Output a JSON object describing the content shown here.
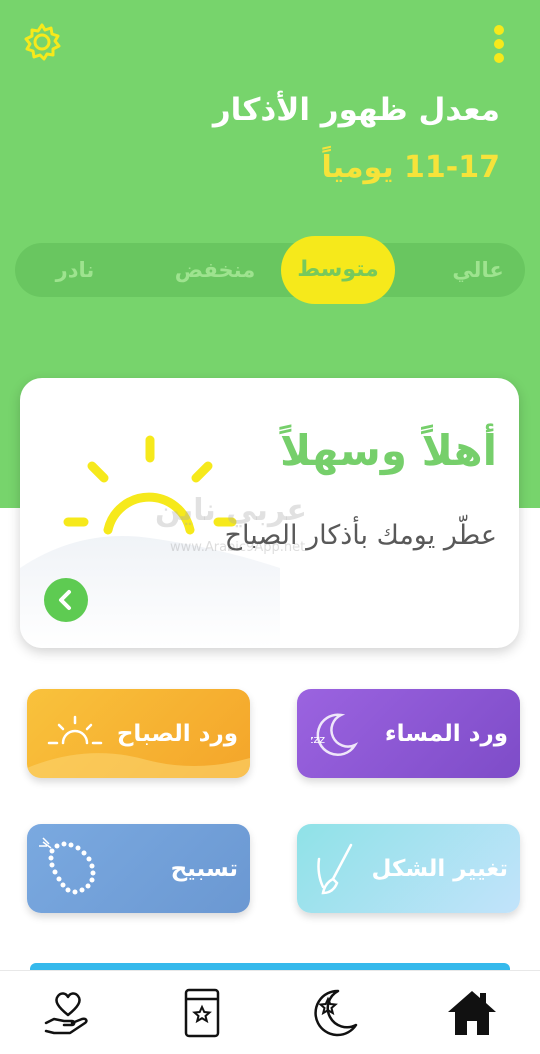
{
  "header": {
    "title": "معدل ظهور الأذكار",
    "frequency": "11-17 يومياً"
  },
  "frequency_selector": {
    "options": [
      "عالي",
      "متوسط",
      "منخفض",
      "نادر"
    ],
    "selected": "متوسط"
  },
  "welcome_card": {
    "title": "أهلاً وسهلاً",
    "text": "عطّر يومك بأذكار الصباح",
    "watermark": "عربي ناين",
    "watermark_sub": "www.Arabic9App.net"
  },
  "tiles": {
    "evening_label": "ورد المساء",
    "morning_label": "ورد الصباح",
    "change_look_label": "تغيير الشكل",
    "tasbih_label": "تسبيح"
  },
  "colors": {
    "primary_green": "#77d46c",
    "accent_yellow": "#f6e91b",
    "evening_purple": "#8c58d3",
    "morning_orange": "#f8b533",
    "change_look_cyan": "#9fe0ec",
    "tasbih_blue": "#6e9fd8"
  },
  "icons": [
    "settings-gear-icon",
    "more-vertical-icon",
    "sun-icon",
    "moon-sleep-icon",
    "sunrise-icon",
    "brush-icon",
    "prayer-beads-icon",
    "home-icon",
    "moon-star-icon",
    "book-star-icon",
    "heart-hand-icon"
  ]
}
